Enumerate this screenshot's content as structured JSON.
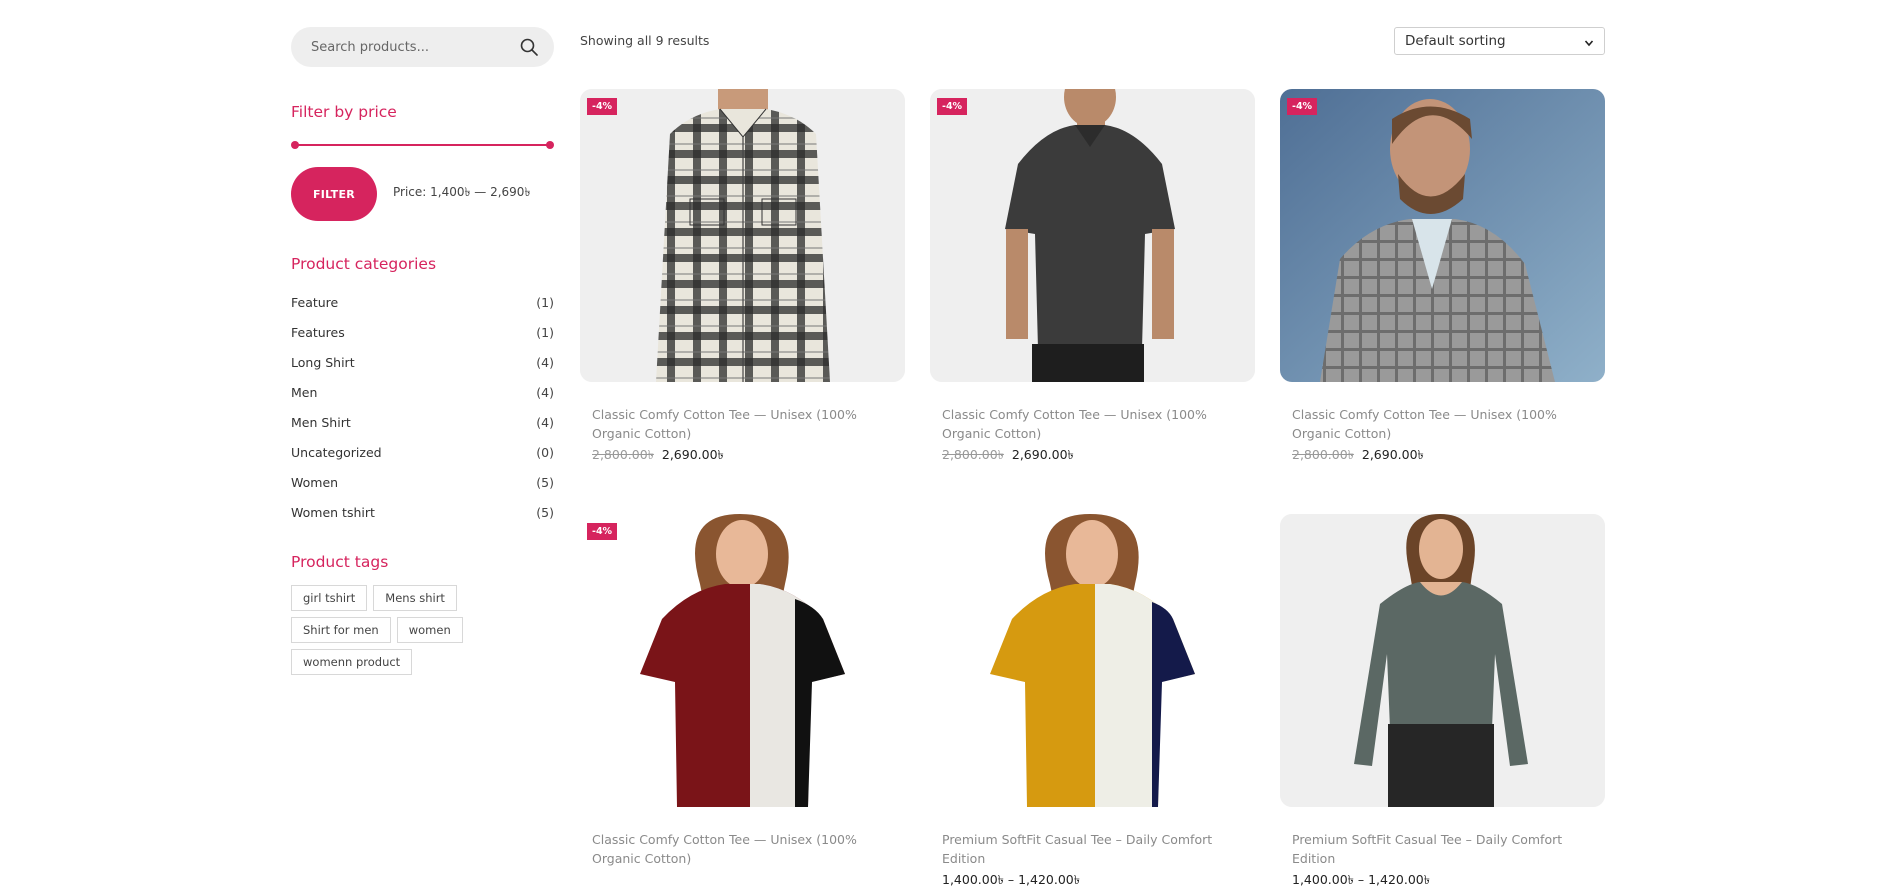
{
  "search": {
    "placeholder": "Search products..."
  },
  "filter_price": {
    "title": "Filter by price",
    "button": "FILTER",
    "price_label": "Price: 1,400৳ — 2,690৳",
    "range_min_fraction": 0.0,
    "range_max_fraction": 1.0
  },
  "categories": {
    "title": "Product categories",
    "items": [
      {
        "label": "Feature",
        "count": "(1)"
      },
      {
        "label": "Features",
        "count": "(1)"
      },
      {
        "label": "Long Shirt",
        "count": "(4)"
      },
      {
        "label": "Men",
        "count": "(4)"
      },
      {
        "label": "Men Shirt",
        "count": "(4)"
      },
      {
        "label": "Uncategorized",
        "count": "(0)"
      },
      {
        "label": "Women",
        "count": "(5)"
      },
      {
        "label": "Women tshirt",
        "count": "(5)"
      }
    ]
  },
  "tags": {
    "title": "Product tags",
    "items": [
      "girl tshirt",
      "Mens shirt",
      "Shirt for men",
      "women",
      "womenn product"
    ]
  },
  "toolbar": {
    "result_count": "Showing all 9 results",
    "sort_selected": "Default sorting"
  },
  "colors": {
    "accent": "#d6245e"
  },
  "products": [
    {
      "badge": "-4%",
      "title": "Classic Comfy Cotton Tee — Unisex (100% Organic Cotton)",
      "old_price": "2,800.00৳",
      "price": "2,690.00৳",
      "image": "plaid-shirt-man"
    },
    {
      "badge": "-4%",
      "title": "Classic Comfy Cotton Tee — Unisex (100% Organic Cotton)",
      "old_price": "2,800.00৳",
      "price": "2,690.00৳",
      "image": "dark-polo-man"
    },
    {
      "badge": "-4%",
      "title": "Classic Comfy Cotton Tee — Unisex (100% Organic Cotton)",
      "old_price": "2,800.00৳",
      "price": "2,690.00৳",
      "image": "plaid-blazer-man"
    },
    {
      "badge": "-4%",
      "title": "Classic Comfy Cotton Tee — Unisex (100% Organic Cotton)",
      "old_price": "",
      "price": "",
      "image": "maroon-colorblock-tee-woman"
    },
    {
      "badge": "",
      "title": "Premium SoftFit Casual Tee – Daily Comfort Edition",
      "old_price": "",
      "price": "1,400.00৳ – 1,420.00৳",
      "image": "mustard-colorblock-tee-woman"
    },
    {
      "badge": "",
      "title": "Premium SoftFit Casual Tee – Daily Comfort Edition",
      "old_price": "",
      "price": "1,400.00৳ – 1,420.00৳",
      "image": "grey-longsleeve-woman"
    }
  ]
}
